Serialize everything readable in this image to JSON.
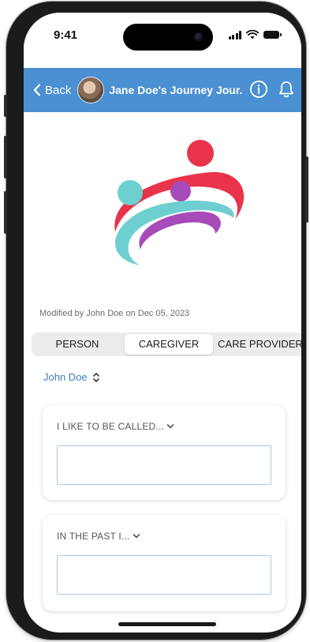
{
  "status_bar": {
    "time": "9:41"
  },
  "header": {
    "back_label": "Back",
    "title": "Jane Doe's Journey Jour...",
    "background_color": "#4a90d2"
  },
  "icons": {
    "back": "chevron-left-icon",
    "info": "info-icon",
    "notifications": "bell-icon"
  },
  "modified_text": "Modified by John Doe on Dec 05, 2023",
  "tabs": [
    {
      "label": "PERSON",
      "active": false
    },
    {
      "label": "CAREGIVER",
      "active": true
    },
    {
      "label": "CARE PROVIDER",
      "active": false
    }
  ],
  "person_picker": {
    "value": "John Doe"
  },
  "cards": [
    {
      "label": "I LIKE TO BE CALLED...",
      "value": ""
    },
    {
      "label": "IN THE PAST I...",
      "value": ""
    }
  ],
  "logo_colors": {
    "red": "#e8334a",
    "teal": "#6ecfd0",
    "purple": "#a64bb8"
  }
}
